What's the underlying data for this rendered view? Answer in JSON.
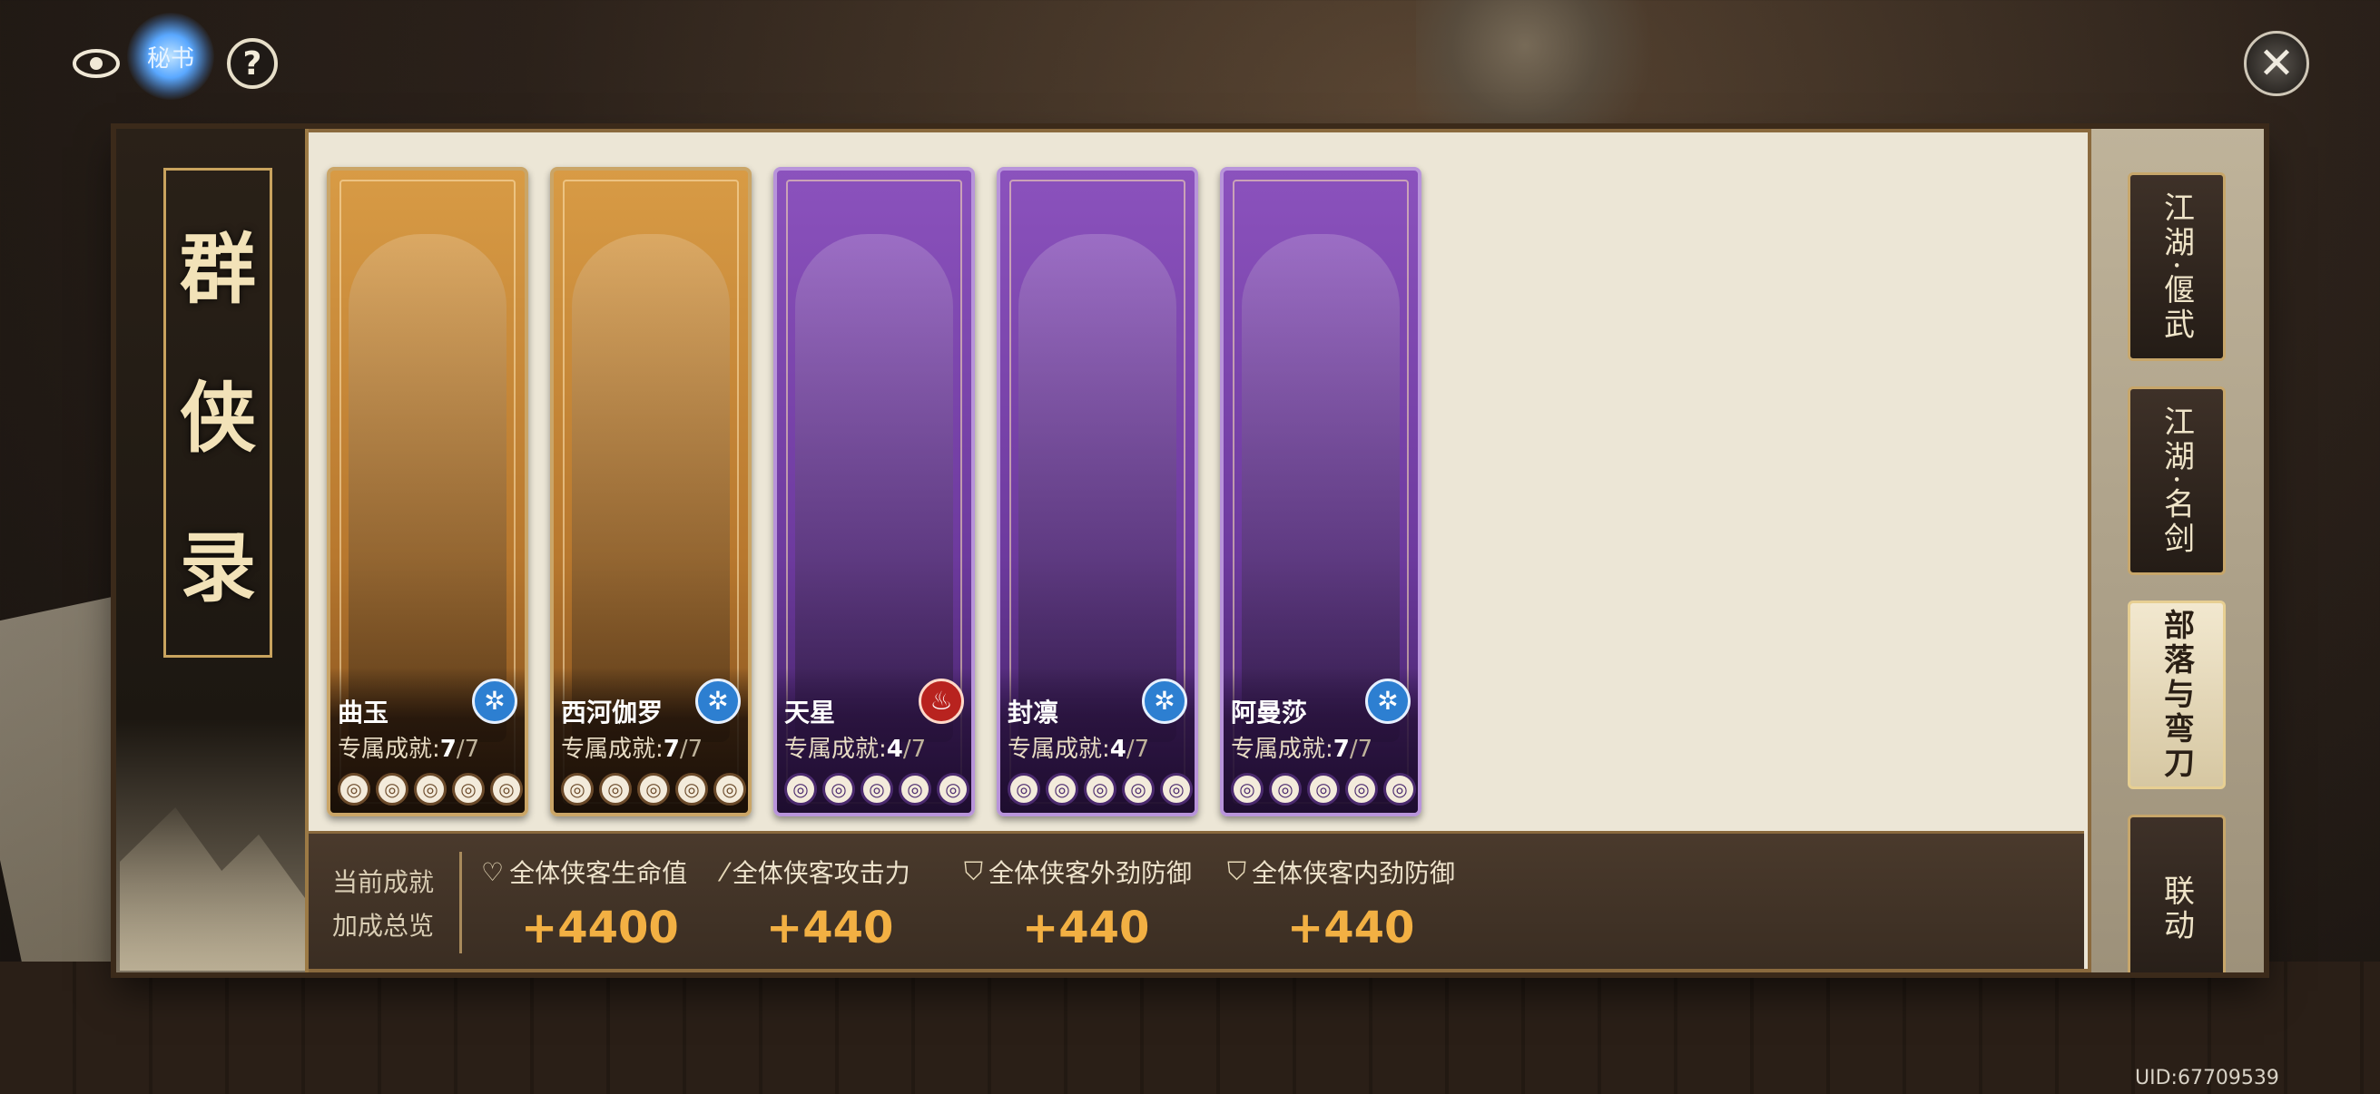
{
  "top_icons": {
    "book_label": "秘书",
    "help_symbol": "?",
    "close_symbol": "✕"
  },
  "title": [
    "群",
    "侠",
    "录"
  ],
  "cards": [
    {
      "name": "曲玉",
      "theme": "orange",
      "element": "frost",
      "element_glyph": "✲",
      "ach_label": "专属成就:",
      "ach_current": "7",
      "ach_total": "/7"
    },
    {
      "name": "西河伽罗",
      "theme": "orange",
      "element": "frost",
      "element_glyph": "✲",
      "ach_label": "专属成就:",
      "ach_current": "7",
      "ach_total": "/7"
    },
    {
      "name": "天星",
      "theme": "purple",
      "element": "fire",
      "element_glyph": "♨",
      "ach_label": "专属成就:",
      "ach_current": "4",
      "ach_total": "/7"
    },
    {
      "name": "封凛",
      "theme": "purple",
      "element": "frost",
      "element_glyph": "✲",
      "ach_label": "专属成就:",
      "ach_current": "4",
      "ach_total": "/7"
    },
    {
      "name": "阿曼莎",
      "theme": "purple",
      "element": "frost",
      "element_glyph": "✲",
      "ach_label": "专属成就:",
      "ach_current": "7",
      "ach_total": "/7"
    }
  ],
  "bonus": {
    "label_line1": "当前成就",
    "label_line2": "加成总览",
    "items": [
      {
        "icon": "heart-icon",
        "glyph": "♡",
        "label": "全体侠客生命值",
        "value": "+4400"
      },
      {
        "icon": "sword-icon",
        "glyph": "⁄",
        "label": "全体侠客攻击力",
        "value": "+440"
      },
      {
        "icon": "shield-icon",
        "glyph": "⛉",
        "label": "全体侠客外劲防御",
        "value": "+440"
      },
      {
        "icon": "shield-icon",
        "glyph": "⛉",
        "label": "全体侠客内劲防御",
        "value": "+440"
      }
    ]
  },
  "tabs": [
    {
      "label": "江湖·偃武",
      "active": false
    },
    {
      "label": "江湖·名剑",
      "active": false
    },
    {
      "label": "部落与弯刀",
      "active": true
    },
    {
      "label": "联动",
      "active": false
    }
  ],
  "uid": "UID:67709539"
}
